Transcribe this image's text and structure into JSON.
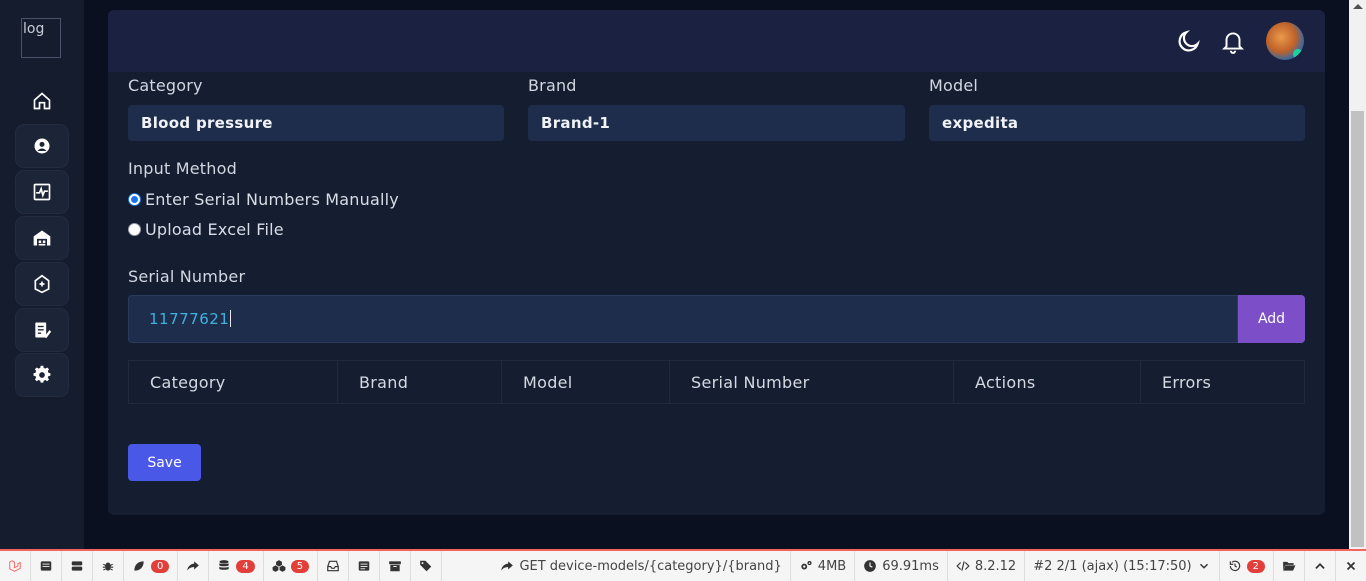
{
  "sidebar": {
    "logo_alt": "log",
    "items": [
      {
        "icon": "home-icon"
      },
      {
        "icon": "user-circle-icon"
      },
      {
        "icon": "activity-monitor-icon"
      },
      {
        "icon": "warehouse-icon"
      },
      {
        "icon": "medical-kit-icon"
      },
      {
        "icon": "document-edit-icon"
      },
      {
        "icon": "gear-icon"
      }
    ]
  },
  "header": {
    "theme_icon": "moon-icon",
    "notification_icon": "bell-icon",
    "avatar_alt": "user avatar"
  },
  "form": {
    "category_label": "Category",
    "category_value": "Blood pressure",
    "brand_label": "Brand",
    "brand_value": "Brand-1",
    "model_label": "Model",
    "model_value": "expedita",
    "input_method_label": "Input Method",
    "option_manual": "Enter Serial Numbers Manually",
    "option_excel": "Upload Excel File",
    "selected_option": "manual",
    "serial_label": "Serial Number",
    "serial_value": "11777621",
    "add_label": "Add",
    "save_label": "Save"
  },
  "table": {
    "columns": [
      "Category",
      "Brand",
      "Model",
      "Serial Number",
      "Actions",
      "Errors"
    ]
  },
  "debugbar": {
    "queries_badge": "0",
    "db_badge": "4",
    "models_badge": "5",
    "route": "GET device-models/{category}/{brand}",
    "memory": "4MB",
    "time": "69.91ms",
    "php_version": "8.2.12",
    "request": "#2 2/1 (ajax) (15:17:50)",
    "history_badge": "2",
    "accent": "#f4645f"
  }
}
